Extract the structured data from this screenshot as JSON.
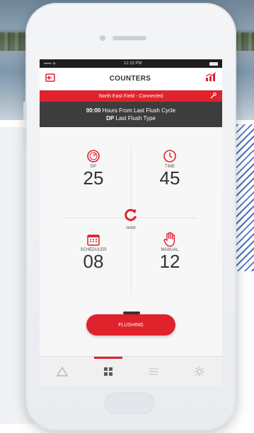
{
  "status_bar": {
    "carrier": "••••• ✈",
    "time": "12:15 PM"
  },
  "header": {
    "title": "COUNTERS"
  },
  "connection_bar": {
    "text": "North East Field - Connected"
  },
  "info": {
    "line1_value": "00:00",
    "line1_text": "Hours From Last Flush Cycle",
    "line2_value": "DP",
    "line2_text": "Last Flush Type"
  },
  "counters": {
    "dp": {
      "label": "DP",
      "value": "25"
    },
    "time": {
      "label": "TIME",
      "value": "45"
    },
    "scheduler": {
      "label": "SCHEDULER",
      "value": "08"
    },
    "manual": {
      "label": "MANUAL",
      "value": "12"
    },
    "reset_label": "reset"
  },
  "flush_button": {
    "label": "FLUSHING"
  },
  "tabs": [
    {
      "icon": "warning-icon",
      "active": false
    },
    {
      "icon": "grid-icon",
      "active": true
    },
    {
      "icon": "list-icon",
      "active": false
    },
    {
      "icon": "gear-icon",
      "active": false
    }
  ],
  "colors": {
    "accent": "#e0222c",
    "dark_bar": "#3d3d3d"
  }
}
